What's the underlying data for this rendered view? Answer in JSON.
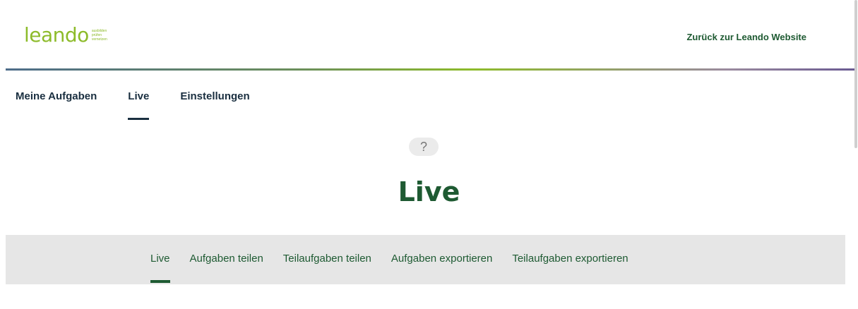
{
  "header": {
    "logo_text": "leando",
    "logo_tagline": [
      "ausbilden",
      "prüfen",
      "vernetzen"
    ],
    "back_link": "Zurück zur Leando Website"
  },
  "main_nav": {
    "items": [
      {
        "label": "Meine Aufgaben",
        "active": false
      },
      {
        "label": "Live",
        "active": true
      },
      {
        "label": "Einstellungen",
        "active": false
      }
    ]
  },
  "help": {
    "icon": "question-mark-icon",
    "symbol": "?"
  },
  "page": {
    "title": "Live"
  },
  "sub_nav": {
    "items": [
      {
        "label": "Live",
        "active": true
      },
      {
        "label": "Aufgaben teilen",
        "active": false
      },
      {
        "label": "Teilaufgaben teilen",
        "active": false
      },
      {
        "label": "Aufgaben exportieren",
        "active": false
      },
      {
        "label": "Teilaufgaben exportieren",
        "active": false
      }
    ]
  },
  "colors": {
    "brand_green": "#8dbb2a",
    "dark_green": "#1e5a32",
    "navy": "#1a2f40",
    "subnav_bg": "#e6e6e6"
  }
}
